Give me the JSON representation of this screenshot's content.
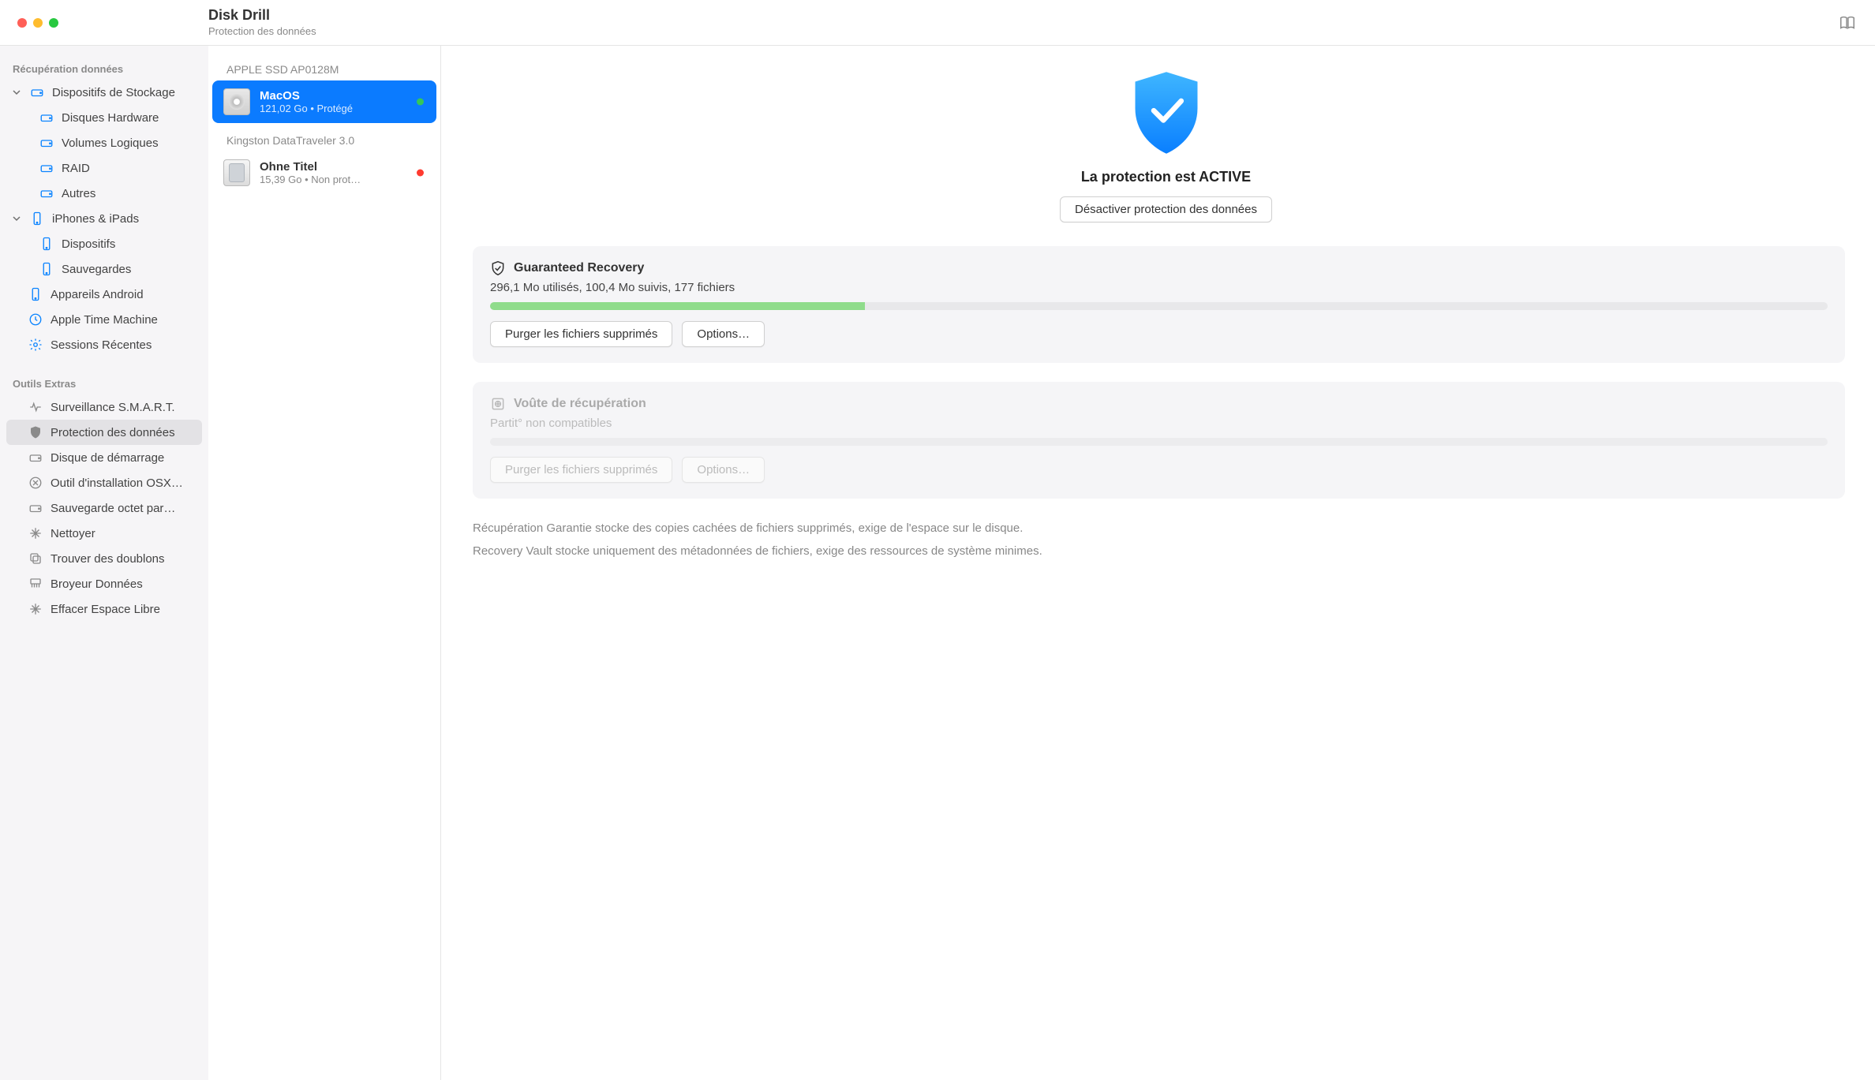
{
  "titlebar": {
    "app_name": "Disk Drill",
    "subtitle": "Protection des données"
  },
  "sidebar": {
    "section_recovery": "Récupération données",
    "section_tools": "Outils Extras",
    "storage_devices": "Dispositifs de Stockage",
    "storage_children": {
      "hardware": "Disques Hardware",
      "logical": "Volumes Logiques",
      "raid": "RAID",
      "other": "Autres"
    },
    "iphones": "iPhones & iPads",
    "iphones_children": {
      "devices": "Dispositifs",
      "backups": "Sauvegardes"
    },
    "android": "Appareils Android",
    "time_machine": "Apple Time Machine",
    "recent_sessions": "Sessions Récentes",
    "tools": {
      "smart": "Surveillance S.M.A.R.T.",
      "data_protection": "Protection des données",
      "boot_disk": "Disque de démarrage",
      "osx_install": "Outil d'installation OSX…",
      "byte_backup": "Sauvegarde octet par…",
      "cleaner": "Nettoyer",
      "dup_finder": "Trouver des doublons",
      "shredder": "Broyeur Données",
      "free_space": "Effacer Espace Libre"
    }
  },
  "drives": {
    "group1": "APPLE SSD AP0128M",
    "d1": {
      "name": "MacOS",
      "sub": "121,02 Go  •  Protégé"
    },
    "group2": "Kingston DataTraveler 3.0",
    "d2": {
      "name": "Ohne Titel",
      "sub": "15,39 Go  •  Non prot…"
    }
  },
  "content": {
    "hero_title": "La protection est ACTIVE",
    "deactivate_btn": "Désactiver protection des données",
    "gr": {
      "title": "Guaranteed Recovery",
      "stats": "296,1 Mo utilisés, 100,4 Mo suivis, 177 fichiers",
      "progress_pct": 28,
      "purge_btn": "Purger les fichiers supprimés",
      "options_btn": "Options…"
    },
    "rv": {
      "title": "Voûte de récupération",
      "stats": "Partit° non compatibles",
      "purge_btn": "Purger les fichiers supprimés",
      "options_btn": "Options…"
    },
    "footer_line1": "Récupération Garantie stocke des copies cachées de fichiers supprimés, exige de l'espace sur le disque.",
    "footer_line2": "Recovery Vault stocke uniquement des métadonnées de fichiers, exige des ressources de système minimes."
  }
}
